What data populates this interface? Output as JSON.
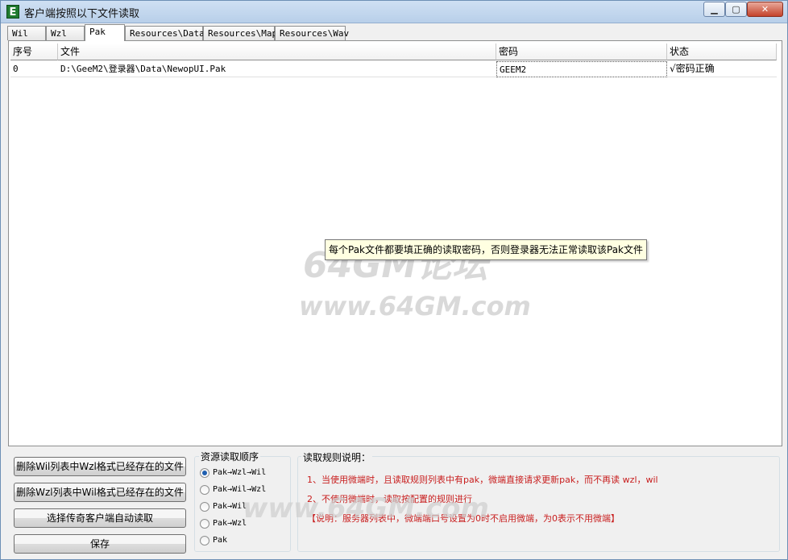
{
  "window": {
    "title": "客户端按照以下文件读取",
    "icon_letter": "E",
    "controls": {
      "minimize": "▁",
      "maximize": "▢",
      "close": "✕"
    }
  },
  "tabs": [
    "Wil",
    "Wzl",
    "Pak",
    "Resources\\Data",
    "Resources\\Map",
    "Resources\\Wav"
  ],
  "active_tab": "Pak",
  "table": {
    "columns": [
      "序号",
      "文件",
      "密码",
      "状态"
    ],
    "rows": [
      {
        "index": "0",
        "file": "D:\\GeeM2\\登录器\\Data\\NewopUI.Pak",
        "password": "GEEM2",
        "status": "√密码正确"
      }
    ]
  },
  "tooltip": "每个Pak文件都要填正确的读取密码，否则登录器无法正常读取该Pak文件",
  "buttons": {
    "delete_wil": "删除Wil列表中Wzl格式已经存在的文件",
    "delete_wzl": "删除Wzl列表中Wil格式已经存在的文件",
    "auto_read": "选择传奇客户端自动读取",
    "save": "保存"
  },
  "read_order": {
    "title": "资源读取顺序",
    "options": [
      "Pak→Wzl→Wil",
      "Pak→Wil→Wzl",
      "Pak→Wil",
      "Pak→Wzl",
      "Pak"
    ],
    "selected_index": 0
  },
  "rules": {
    "title": "读取规则说明：",
    "items": [
      "1、当使用微端时，且读取规则列表中有pak，微端直接请求更新pak，而不再读 wzl，wil",
      "2、不使用微端时，读取按配置的规则进行",
      "【说明：服务器列表中，微端端口号设置为0时不启用微端，为0表示不用微端】"
    ]
  },
  "watermarks": [
    "64GM论坛",
    "www.64GM.com",
    "www.64GM.com"
  ],
  "colors": {
    "rule_text": "#c81e1e",
    "tooltip_bg": "#ffffe1",
    "window_bg": "#f0f0f0",
    "radio_accent": "#1f5fb0"
  }
}
